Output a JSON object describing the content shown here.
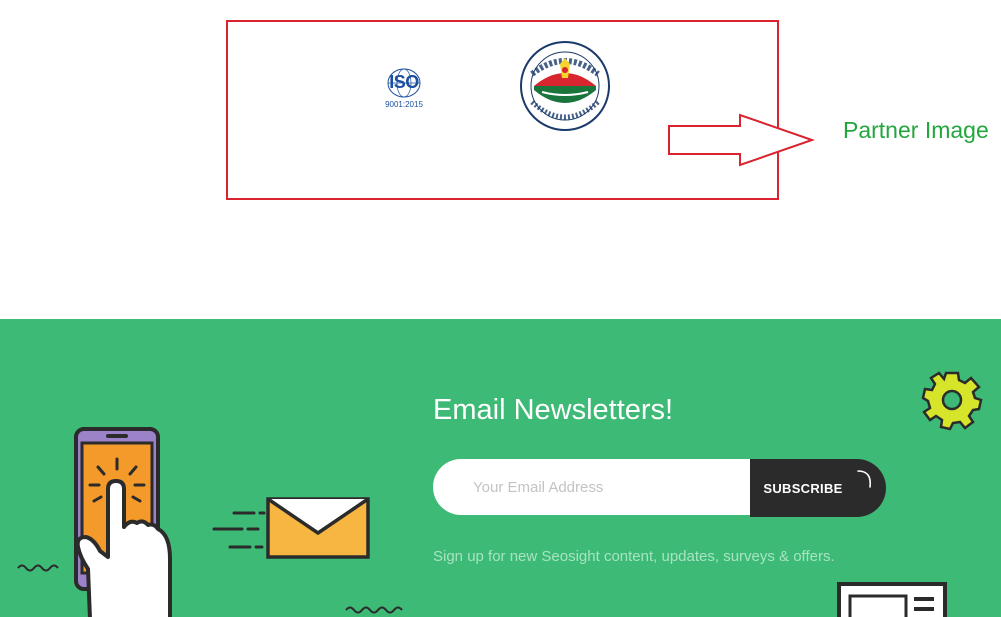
{
  "partners": {
    "iso_logo": {
      "name": "ISO",
      "certification": "9001:2015"
    },
    "city_logo_name": "Barisal City Corporation seal",
    "label": "Partner Image",
    "colors": {
      "box_border": "#d9232e",
      "label": "#23a63c"
    }
  },
  "newsletter": {
    "title": "Email Newsletters!",
    "email_placeholder": "Your Email Address",
    "email_value": "",
    "subscribe_label": "SUBSCRIBE",
    "description": "Sign up for new Seosight content, updates, surveys & offers.",
    "colors": {
      "background": "#3dba76",
      "button": "#2b2b2b",
      "gear": "#d6e42a"
    },
    "icons": [
      "gear-icon",
      "phone-tap-illustration",
      "envelope-illustration",
      "newspaper-illustration"
    ]
  }
}
